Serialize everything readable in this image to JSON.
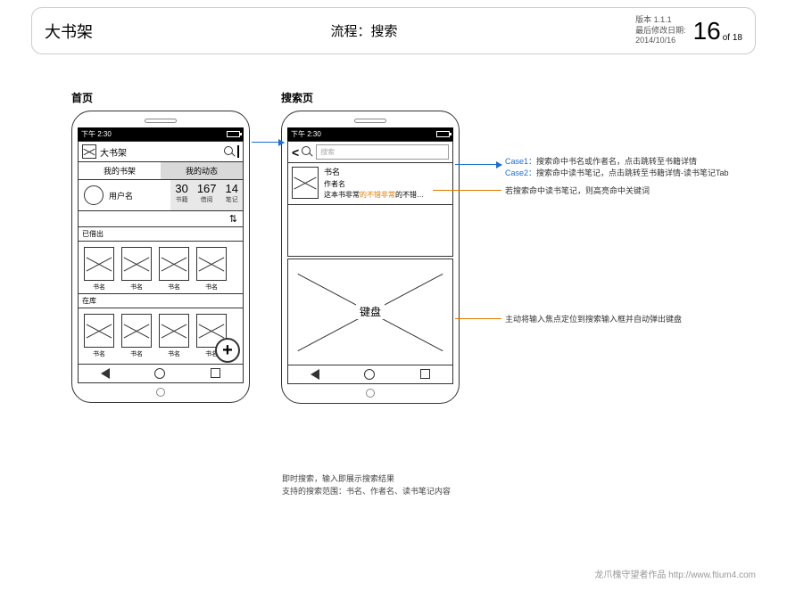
{
  "header": {
    "app_name": "大书架",
    "flow_title": "流程：搜索",
    "version_label": "版本 1.1.1",
    "modified_label": "最后修改日期:",
    "modified_date": "2014/10/16",
    "page_num": "16",
    "page_of": "of 18"
  },
  "screen1": {
    "label": "首页",
    "statusbar_time": "下午 2:30",
    "app_title": "大书架",
    "tab_shelf": "我的书架",
    "tab_activity": "我的动态",
    "username": "用户名",
    "stats": [
      {
        "num": "30",
        "lbl": "书籍"
      },
      {
        "num": "167",
        "lbl": "借阅"
      },
      {
        "num": "14",
        "lbl": "笔记"
      }
    ],
    "sort_icon": "⇅",
    "section_lent": "已借出",
    "section_stock": "在库",
    "book_name": "书名"
  },
  "screen2": {
    "label": "搜索页",
    "statusbar_time": "下午 2:30",
    "search_placeholder": "搜索",
    "result_title": "书名",
    "result_author": "作者名",
    "result_note_pre": "这本书非常",
    "result_note_hl": "的不错非常",
    "result_note_post": "的不错…",
    "keyboard_label": "键盘"
  },
  "annotations": {
    "case1_k": "Case1：",
    "case1": "搜索命中书名或作者名，点击跳转至书籍详情",
    "case2_k": "Case2：",
    "case2": "搜索命中读书笔记，点击跳转至书籍详情-读书笔记Tab",
    "highlight_note": "若搜索命中读书笔记，则高亮命中关键词",
    "keyboard_note": "主动将输入焦点定位到搜索输入框并自动弹出键盘",
    "footer_l1": "即时搜索，输入即展示搜索结果",
    "footer_l2": "支持的搜索范围：书名、作者名、读书笔记内容"
  },
  "credit": "龙爪槐守望者作品  http://www.ftium4.com"
}
